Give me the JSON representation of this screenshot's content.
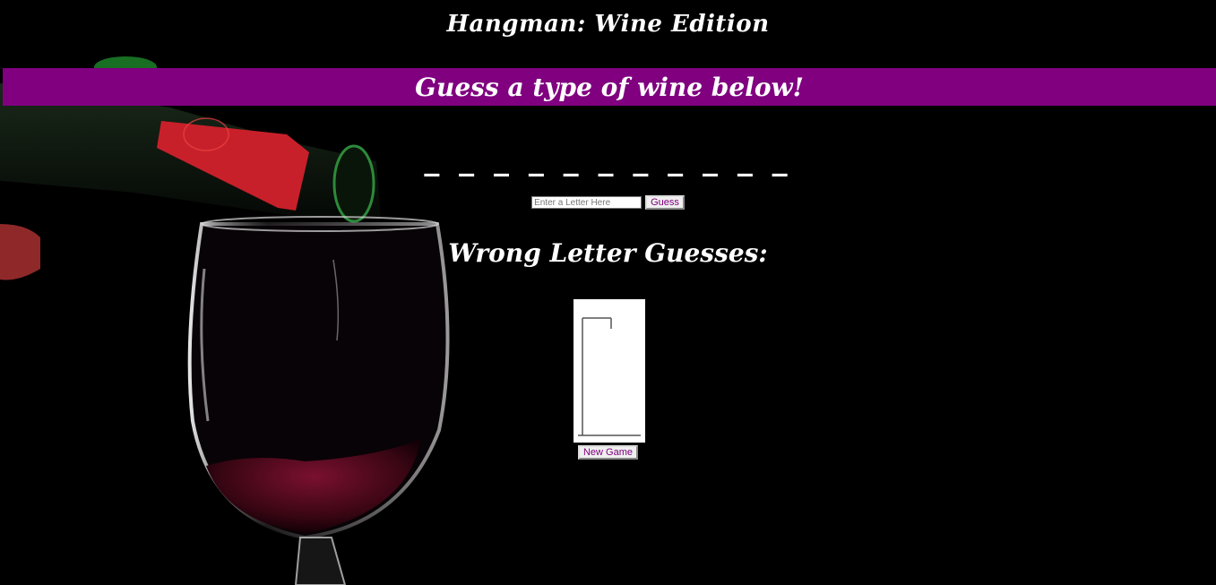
{
  "page": {
    "title": "Hangman: Wine Edition",
    "banner": "Guess a type of wine below!"
  },
  "game": {
    "word_blanks": "_ _ _ _ _ _ _ _ _ _ _",
    "blank_count": 11,
    "wrong_heading": "Wrong Letter Guesses:",
    "wrong_letters": ""
  },
  "guess_form": {
    "input_placeholder": "Enter a Letter Here",
    "input_value": "",
    "guess_button": "Guess"
  },
  "controls": {
    "new_game_button": "New Game"
  },
  "colors": {
    "banner_bg": "#800080",
    "button_text": "#800080",
    "page_bg": "#000000"
  }
}
